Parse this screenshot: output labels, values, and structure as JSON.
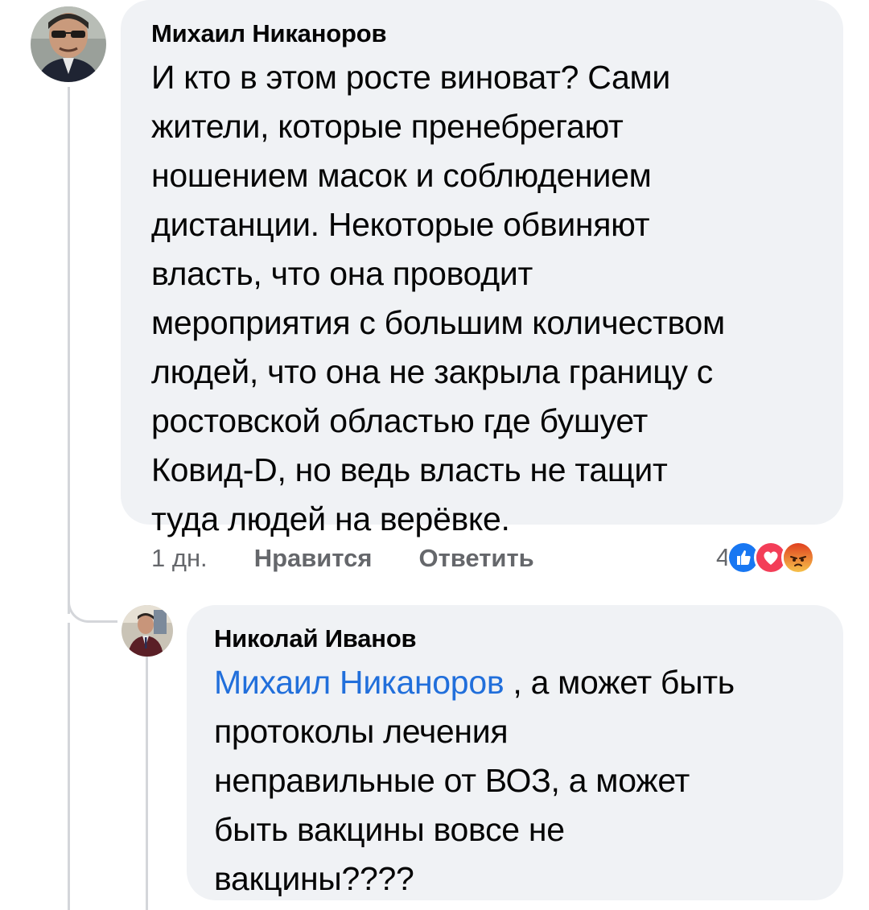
{
  "comment": {
    "author": "Михаил Никаноров",
    "text_lines": [
      "И кто в этом росте виноват? Сами",
      "жители, которые пренебрегают",
      "ношением масок и соблюдением",
      "дистанции. Некоторые обвиняют",
      "власть, что она проводит",
      "мероприятия с большим количеством",
      "людей, что она не закрыла границу с",
      "ростовской областью где бушует",
      "Ковид-D, но ведь власть не тащит",
      "туда людей на верёвке."
    ],
    "time": "1 дн.",
    "like_label": "Нравится",
    "reply_label": "Ответить",
    "reaction_count": "4",
    "reactions": [
      "like-icon",
      "love-icon",
      "angry-icon"
    ]
  },
  "reply": {
    "author": "Николай Иванов",
    "mention": "Михаил Никаноров",
    "first_line_rest": " , а может быть",
    "text_lines": [
      "протоколы лечения",
      "неправильные от ВОЗ, а может",
      "быть вакцины вовсе не",
      "вакцины????"
    ]
  },
  "colors": {
    "bubble": "#f0f2f5",
    "mention": "#216fdb",
    "secondary_text": "#65676b",
    "like": "#1877f2",
    "love": "#f33e58",
    "angry": "#e9710f"
  }
}
